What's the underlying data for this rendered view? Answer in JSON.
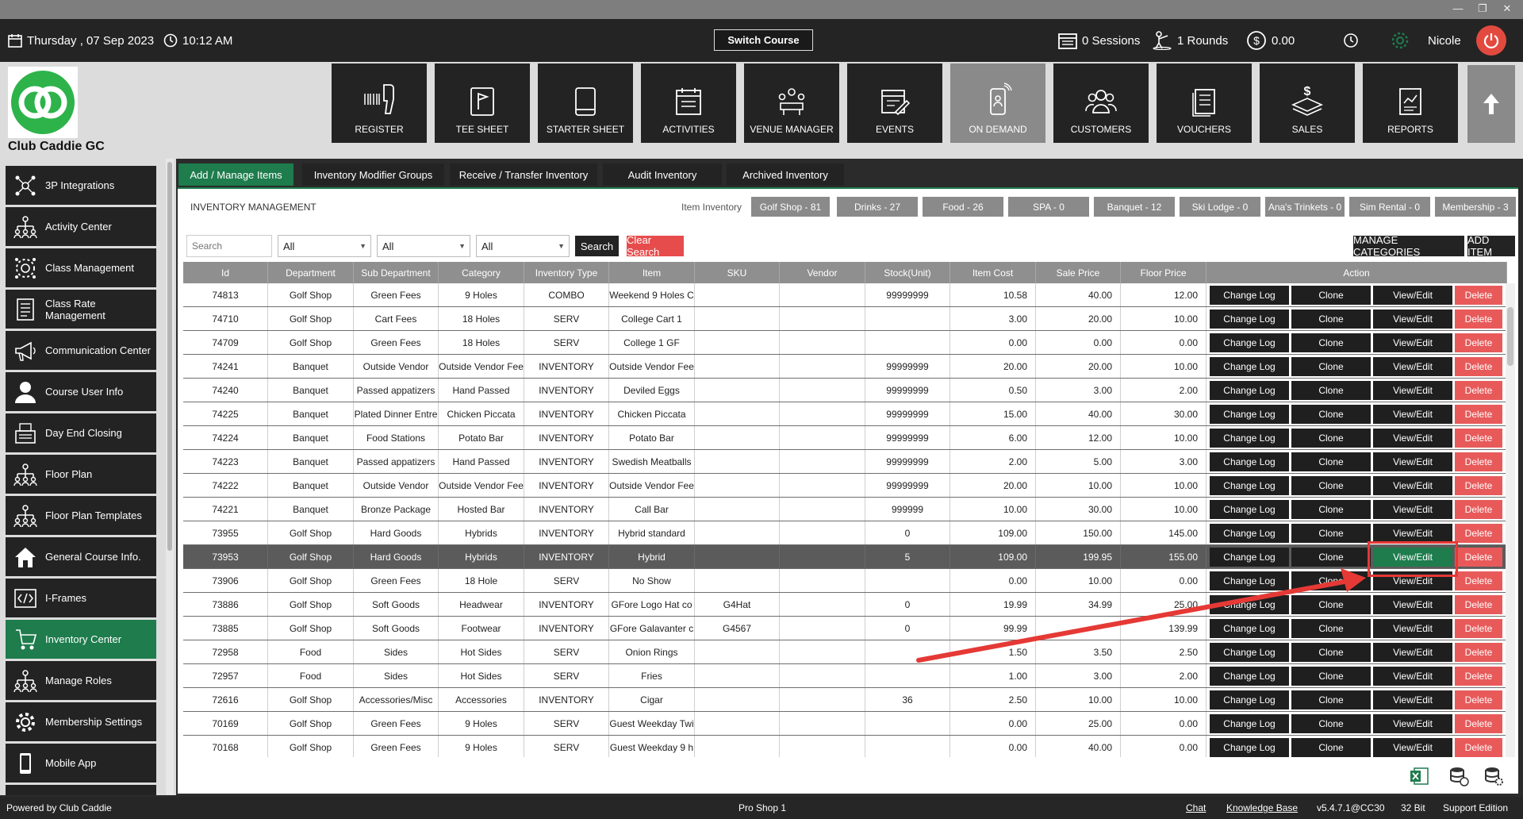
{
  "topbar": {
    "date": "Thursday ,  07 Sep 2023",
    "time": "10:12 AM",
    "switch_course": "Switch Course",
    "sessions": "0 Sessions",
    "rounds": "1 Rounds",
    "amount": "0.00",
    "user": "Nicole"
  },
  "club": {
    "name": "Club Caddie GC"
  },
  "nav": [
    {
      "label": "REGISTER",
      "icon": "barcode-scanner-icon"
    },
    {
      "label": "TEE SHEET",
      "icon": "flag-icon"
    },
    {
      "label": "STARTER SHEET",
      "icon": "tablet-icon"
    },
    {
      "label": "ACTIVITIES",
      "icon": "calendar-list-icon"
    },
    {
      "label": "VENUE MANAGER",
      "icon": "meeting-icon"
    },
    {
      "label": "EVENTS",
      "icon": "calendar-edit-icon"
    },
    {
      "label": "ON DEMAND",
      "icon": "mobile-order-icon"
    },
    {
      "label": "CUSTOMERS",
      "icon": "users-icon"
    },
    {
      "label": "VOUCHERS",
      "icon": "voucher-icon"
    },
    {
      "label": "SALES",
      "icon": "money-icon"
    },
    {
      "label": "REPORTS",
      "icon": "report-icon"
    }
  ],
  "sidebar": {
    "items": [
      {
        "label": "3P Integrations",
        "icon": "network-icon"
      },
      {
        "label": "Activity  Center",
        "icon": "org-chart-icon"
      },
      {
        "label": "Class Management",
        "icon": "class-gear-icon"
      },
      {
        "label": "Class Rate Management",
        "icon": "document-list-icon"
      },
      {
        "label": "Communication Center",
        "icon": "megaphone-icon"
      },
      {
        "label": "Course User Info",
        "icon": "user-icon"
      },
      {
        "label": "Day End Closing",
        "icon": "register-close-icon"
      },
      {
        "label": "Floor Plan",
        "icon": "org-chart-icon"
      },
      {
        "label": "Floor Plan Templates",
        "icon": "org-chart-icon"
      },
      {
        "label": "General Course Info.",
        "icon": "home-icon"
      },
      {
        "label": "I-Frames",
        "icon": "code-icon"
      },
      {
        "label": "Inventory Center",
        "icon": "inventory-icon"
      },
      {
        "label": "Manage Roles",
        "icon": "org-chart-icon"
      },
      {
        "label": "Membership Settings",
        "icon": "gear-icon"
      },
      {
        "label": "Mobile App",
        "icon": "mobile-icon"
      }
    ]
  },
  "tabs": [
    {
      "label": "Add / Manage Items"
    },
    {
      "label": "Inventory Modifier Groups"
    },
    {
      "label": "Receive / Transfer Inventory"
    },
    {
      "label": "Audit Inventory"
    },
    {
      "label": "Archived Inventory"
    }
  ],
  "panel": {
    "title": "INVENTORY MANAGEMENT",
    "item_inventory_label": "Item Inventory",
    "chips": [
      "Golf Shop - 81",
      "Drinks - 27",
      "Food - 26",
      "SPA - 0",
      "Banquet  - 12",
      "Ski Lodge - 0",
      "Ana's Trinkets  - 0",
      "Sim Rental - 0",
      "Membership - 3"
    ]
  },
  "filters": {
    "search_placeholder": "Search",
    "dropdowns": [
      "All",
      "All",
      "All"
    ],
    "search_btn": "Search",
    "clear_btn": "Clear Search",
    "manage_categories": "MANAGE CATEGORIES",
    "add_item": "ADD ITEM"
  },
  "table": {
    "headers": [
      "Id",
      "Department",
      "Sub Department",
      "Category",
      "Inventory Type",
      "Item",
      "SKU",
      "Vendor",
      "Stock(Unit)",
      "Item Cost",
      "Sale Price",
      "Floor Price",
      "Action"
    ],
    "actions": {
      "change_log": "Change Log",
      "clone": "Clone",
      "view_edit": "View/Edit",
      "delete": "Delete"
    },
    "selected_row_id": "73953",
    "rows": [
      [
        "74813",
        "Golf Shop",
        "Green Fees",
        "9 Holes",
        "COMBO",
        "Weekend 9 Holes C",
        "",
        "",
        "99999999",
        "10.58",
        "40.00",
        "12.00"
      ],
      [
        "74710",
        "Golf Shop",
        "Cart Fees",
        "18 Holes",
        "SERV",
        "College Cart 1",
        "",
        "",
        "",
        "3.00",
        "20.00",
        "10.00"
      ],
      [
        "74709",
        "Golf Shop",
        "Green Fees",
        "18 Holes",
        "SERV",
        "College 1 GF",
        "",
        "",
        "",
        "0.00",
        "0.00",
        "0.00"
      ],
      [
        "74241",
        "Banquet",
        "Outside Vendor",
        "Outside Vendor Fee",
        "INVENTORY",
        "Outside Vendor Fee",
        "",
        "",
        "99999999",
        "20.00",
        "20.00",
        "10.00"
      ],
      [
        "74240",
        "Banquet",
        "Passed appatizers",
        "Hand Passed",
        "INVENTORY",
        "Deviled Eggs",
        "",
        "",
        "99999999",
        "0.50",
        "3.00",
        "2.00"
      ],
      [
        "74225",
        "Banquet",
        "Plated Dinner Entre",
        "Chicken Piccata",
        "INVENTORY",
        "Chicken Piccata",
        "",
        "",
        "99999999",
        "15.00",
        "40.00",
        "30.00"
      ],
      [
        "74224",
        "Banquet",
        "Food Stations",
        "Potato Bar",
        "INVENTORY",
        "Potato Bar",
        "",
        "",
        "99999999",
        "6.00",
        "12.00",
        "10.00"
      ],
      [
        "74223",
        "Banquet",
        "Passed appatizers",
        "Hand Passed",
        "INVENTORY",
        "Swedish Meatballs",
        "",
        "",
        "99999999",
        "2.00",
        "5.00",
        "3.00"
      ],
      [
        "74222",
        "Banquet",
        "Outside Vendor",
        "Outside Vendor Fee",
        "INVENTORY",
        "Outside Vendor Fee",
        "",
        "",
        "99999999",
        "20.00",
        "10.00",
        "10.00"
      ],
      [
        "74221",
        "Banquet",
        "Bronze Package",
        "Hosted Bar",
        "INVENTORY",
        "Call Bar",
        "",
        "",
        "999999",
        "10.00",
        "30.00",
        "10.00"
      ],
      [
        "73955",
        "Golf Shop",
        "Hard Goods",
        "Hybrids",
        "INVENTORY",
        "Hybrid standard",
        "",
        "",
        "0",
        "109.00",
        "150.00",
        "145.00"
      ],
      [
        "73953",
        "Golf Shop",
        "Hard Goods",
        "Hybrids",
        "INVENTORY",
        "Hybrid",
        "",
        "",
        "5",
        "109.00",
        "199.95",
        "155.00"
      ],
      [
        "73906",
        "Golf Shop",
        "Green Fees",
        "18 Hole",
        "SERV",
        "No Show",
        "",
        "",
        "",
        "0.00",
        "10.00",
        "0.00"
      ],
      [
        "73886",
        "Golf Shop",
        "Soft Goods",
        "Headwear",
        "INVENTORY",
        "GFore Logo Hat co",
        "G4Hat",
        "",
        "0",
        "19.99",
        "34.99",
        "25.00"
      ],
      [
        "73885",
        "Golf Shop",
        "Soft Goods",
        "Footwear",
        "INVENTORY",
        "GFore Galavanter c",
        "G4567",
        "",
        "0",
        "99.99",
        "",
        "139.99"
      ],
      [
        "72958",
        "Food",
        "Sides",
        "Hot Sides",
        "SERV",
        "Onion Rings",
        "",
        "",
        "",
        "1.50",
        "3.50",
        "2.50"
      ],
      [
        "72957",
        "Food",
        "Sides",
        "Hot Sides",
        "SERV",
        "Fries",
        "",
        "",
        "",
        "1.00",
        "3.00",
        "2.00"
      ],
      [
        "72616",
        "Golf Shop",
        "Accessories/Misc",
        "Accessories",
        "INVENTORY",
        "Cigar",
        "",
        "",
        "36",
        "2.50",
        "10.00",
        "10.00"
      ],
      [
        "70169",
        "Golf Shop",
        "Green Fees",
        "9 Holes",
        "SERV",
        "Guest Weekday Twi",
        "",
        "",
        "",
        "0.00",
        "25.00",
        "0.00"
      ],
      [
        "70168",
        "Golf Shop",
        "Green Fees",
        "9 Holes",
        "SERV",
        "Guest Weekday 9 h",
        "",
        "",
        "",
        "0.00",
        "40.00",
        "0.00"
      ]
    ]
  },
  "footer": {
    "powered_by": "Powered by Club Caddie",
    "location": "Pro Shop 1",
    "chat": "Chat",
    "knowledge_base": "Knowledge Base",
    "version": "v5.4.7.1@CC30",
    "bits": "32 Bit",
    "support": "Support Edition"
  },
  "colors": {
    "accent_green": "#1e7c4d",
    "delete_red": "#e85a5a",
    "annotation_red": "#e53935",
    "dark_tile": "#232323"
  }
}
